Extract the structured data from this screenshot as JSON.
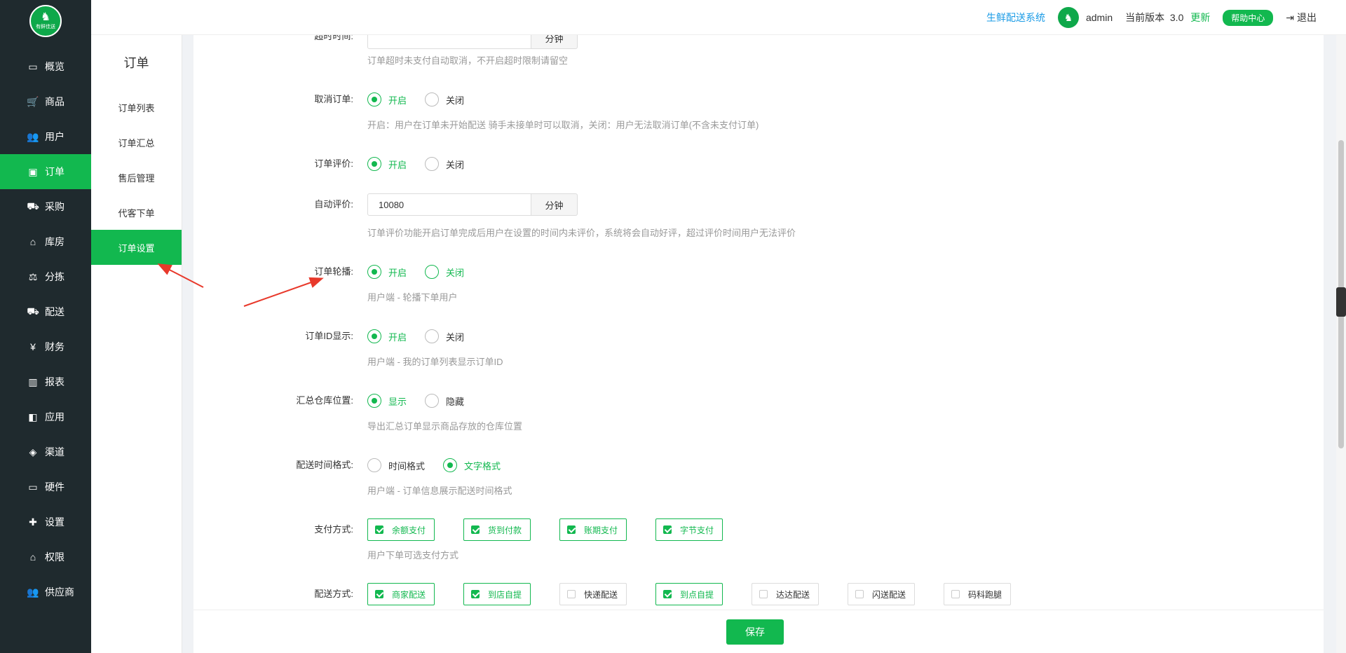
{
  "brand": {
    "logo_text": "有鲜佳送"
  },
  "sidebar": {
    "items": [
      {
        "icon": "monitor-icon",
        "glyph": "▭",
        "label": "概览",
        "active": false
      },
      {
        "icon": "cart-icon",
        "glyph": "🛒",
        "label": "商品",
        "active": false
      },
      {
        "icon": "users-icon",
        "glyph": "👥",
        "label": "用户",
        "active": false
      },
      {
        "icon": "money-icon",
        "glyph": "▣",
        "label": "订单",
        "active": true
      },
      {
        "icon": "bus-icon",
        "glyph": "⛟",
        "label": "采购",
        "active": false
      },
      {
        "icon": "home-icon",
        "glyph": "⌂",
        "label": "库房",
        "active": false
      },
      {
        "icon": "scale-icon",
        "glyph": "⚖",
        "label": "分拣",
        "active": false
      },
      {
        "icon": "truck-icon",
        "glyph": "⛟",
        "label": "配送",
        "active": false
      },
      {
        "icon": "yen-icon",
        "glyph": "¥",
        "label": "财务",
        "active": false
      },
      {
        "icon": "bar-chart-icon",
        "glyph": "▥",
        "label": "报表",
        "active": false
      },
      {
        "icon": "apps-icon",
        "glyph": "◧",
        "label": "应用",
        "active": false
      },
      {
        "icon": "cube-icon",
        "glyph": "◈",
        "label": "渠道",
        "active": false
      },
      {
        "icon": "desktop-icon",
        "glyph": "▭",
        "label": "硬件",
        "active": false
      },
      {
        "icon": "puzzle-icon",
        "glyph": "✚",
        "label": "设置",
        "active": false
      },
      {
        "icon": "bank-icon",
        "glyph": "⌂",
        "label": "权限",
        "active": false
      },
      {
        "icon": "supplier-icon",
        "glyph": "👥",
        "label": "供应商",
        "active": false
      }
    ]
  },
  "subbar": {
    "title": "订单",
    "items": [
      {
        "label": "订单列表",
        "active": false
      },
      {
        "label": "订单汇总",
        "active": false
      },
      {
        "label": "售后管理",
        "active": false
      },
      {
        "label": "代客下单",
        "active": false
      },
      {
        "label": "订单设置",
        "active": true
      }
    ]
  },
  "header": {
    "system_link": "生鲜配送系统",
    "avatar_text": "有鲜佳送",
    "username": "admin",
    "version_label": "当前版本",
    "version": "3.0",
    "update_label": "更新",
    "help_label": "帮助中心",
    "logout_label": "退出"
  },
  "form": {
    "timeout": {
      "label": "超时时间:",
      "unit": "分钟",
      "hint": "订单超时未支付自动取消，不开启超时限制请留空"
    },
    "cancel_order": {
      "label": "取消订单:",
      "options": [
        "开启",
        "关闭"
      ],
      "selected": 0,
      "hint": "开启：用户在订单未开始配送 骑手未接单时可以取消，关闭：用户无法取消订单(不含未支付订单)"
    },
    "order_review": {
      "label": "订单评价:",
      "options": [
        "开启",
        "关闭"
      ],
      "selected": 0
    },
    "auto_review": {
      "label": "自动评价:",
      "value": "10080",
      "unit": "分钟",
      "hint": "订单评价功能开启订单完成后用户在设置的时间内未评价，系统将会自动好评，超过评价时间用户无法评价"
    },
    "order_carousel": {
      "label": "订单轮播:",
      "options": [
        "开启",
        "关闭"
      ],
      "selected": 0,
      "hint": "用户端 - 轮播下单用户"
    },
    "order_id_display": {
      "label": "订单ID显示:",
      "options": [
        "开启",
        "关闭"
      ],
      "selected": 0,
      "hint": "用户端 - 我的订单列表显示订单ID"
    },
    "warehouse_location": {
      "label": "汇总仓库位置:",
      "options": [
        "显示",
        "隐藏"
      ],
      "selected": 0,
      "hint": "导出汇总订单显示商品存放的仓库位置"
    },
    "delivery_time_format": {
      "label": "配送时间格式:",
      "options": [
        "时间格式",
        "文字格式"
      ],
      "selected": 1,
      "hint": "用户端 - 订单信息展示配送时间格式"
    },
    "payment_methods": {
      "label": "支付方式:",
      "items": [
        {
          "label": "余额支付",
          "checked": true
        },
        {
          "label": "货到付款",
          "checked": true
        },
        {
          "label": "账期支付",
          "checked": true
        },
        {
          "label": "字节支付",
          "checked": true
        }
      ],
      "hint": "用户下单可选支付方式"
    },
    "delivery_methods": {
      "label": "配送方式:",
      "items": [
        {
          "label": "商家配送",
          "checked": true
        },
        {
          "label": "到店自提",
          "checked": true
        },
        {
          "label": "快递配送",
          "checked": false
        },
        {
          "label": "到点自提",
          "checked": true
        },
        {
          "label": "达达配送",
          "checked": false
        },
        {
          "label": "闪送配送",
          "checked": false
        },
        {
          "label": "码科跑腿",
          "checked": false
        }
      ]
    }
  },
  "footer": {
    "save_label": "保存"
  },
  "colors": {
    "accent": "#12b84f",
    "sidebar_bg": "#1f2a2e",
    "link": "#1a9be6",
    "arrow": "#e8392b"
  }
}
